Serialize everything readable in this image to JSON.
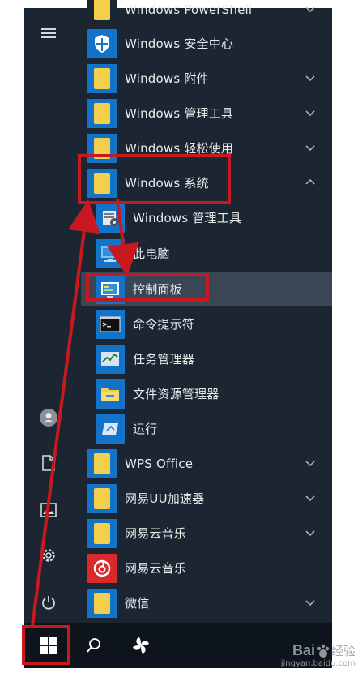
{
  "rail": {
    "icons": [
      "hamburger-menu-icon",
      "user-avatar-icon",
      "documents-icon",
      "pictures-icon",
      "settings-gear-icon",
      "power-icon"
    ]
  },
  "app_list": {
    "items": [
      {
        "label": "Windows PowerShell",
        "icon": "folder-icon",
        "expandable": true
      },
      {
        "label": "Windows 安全中心",
        "icon": "shield-icon",
        "expandable": false
      },
      {
        "label": "Windows 附件",
        "icon": "folder-icon",
        "expandable": true
      },
      {
        "label": "Windows 管理工具",
        "icon": "folder-icon",
        "expandable": true
      },
      {
        "label": "Windows 轻松使用",
        "icon": "folder-icon",
        "expandable": true
      },
      {
        "label": "Windows 系统",
        "icon": "folder-icon",
        "expandable": true,
        "expanded": true
      },
      {
        "label": "Windows 管理工具",
        "icon": "admin-tools-icon",
        "sub": true
      },
      {
        "label": "此电脑",
        "icon": "this-pc-icon",
        "sub": true
      },
      {
        "label": "控制面板",
        "icon": "control-panel-icon",
        "sub": true,
        "selected": true
      },
      {
        "label": "命令提示符",
        "icon": "cmd-icon",
        "sub": true
      },
      {
        "label": "任务管理器",
        "icon": "task-manager-icon",
        "sub": true
      },
      {
        "label": "文件资源管理器",
        "icon": "file-explorer-icon",
        "sub": true
      },
      {
        "label": "运行",
        "icon": "run-icon",
        "sub": true
      },
      {
        "label": "WPS Office",
        "icon": "folder-icon",
        "expandable": true
      },
      {
        "label": "网易UU加速器",
        "icon": "folder-icon",
        "expandable": true
      },
      {
        "label": "网易云音乐",
        "icon": "folder-icon",
        "expandable": true
      },
      {
        "label": "网易云音乐",
        "icon": "netease-music-icon",
        "expandable": false
      },
      {
        "label": "微信",
        "icon": "folder-icon",
        "expandable": true
      }
    ]
  },
  "taskbar": {
    "icons": [
      "windows-start-icon",
      "search-icon",
      "app-pinwheel-icon"
    ]
  },
  "watermark": {
    "brand": "Bai",
    "brand_suffix": "经验",
    "url": "jingyan.baidu.com"
  },
  "colors": {
    "menu_bg": "#1c2532",
    "tile_blue": "#1273c9",
    "folder_yellow": "#f3cf4c",
    "annotation_red": "#c7191f"
  }
}
